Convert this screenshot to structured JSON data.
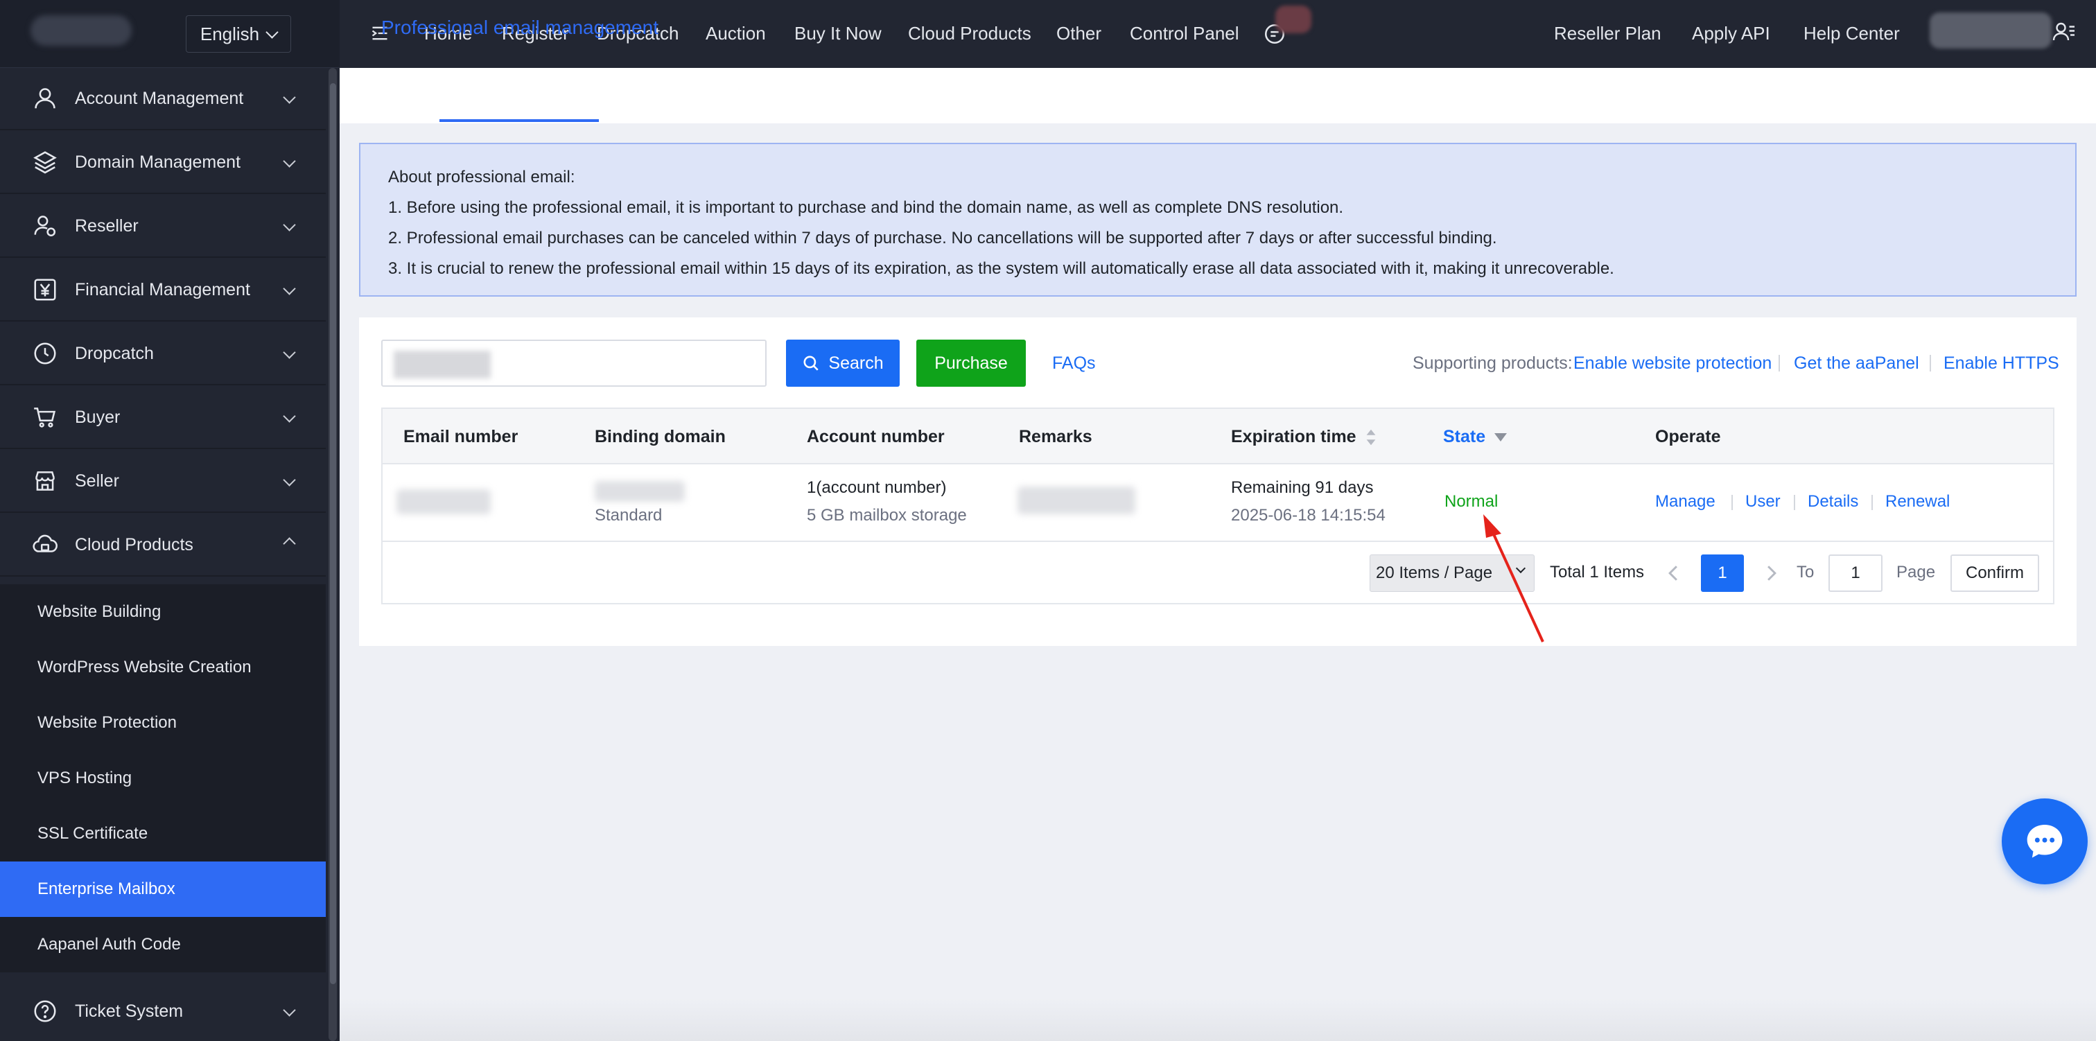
{
  "sidebar": {
    "language": "English",
    "menu": [
      {
        "label": "Account Management",
        "icon": "user-icon"
      },
      {
        "label": "Domain Management",
        "icon": "layers-icon"
      },
      {
        "label": "Reseller",
        "icon": "reseller-icon"
      },
      {
        "label": "Financial Management",
        "icon": "yen-icon"
      },
      {
        "label": "Dropcatch",
        "icon": "clock-icon"
      },
      {
        "label": "Buyer",
        "icon": "cart-icon"
      },
      {
        "label": "Seller",
        "icon": "store-icon"
      },
      {
        "label": "Cloud Products",
        "icon": "cloud-icon"
      }
    ],
    "submenu": [
      "Website Building",
      "WordPress Website Creation",
      "Website Protection",
      "VPS Hosting",
      "SSL Certificate",
      "Enterprise Mailbox",
      "Aapanel Auth Code"
    ],
    "active_submenu": "Enterprise Mailbox",
    "ticket": "Ticket System"
  },
  "topnav": {
    "links": [
      "Home",
      "Register",
      "Dropcatch",
      "Auction",
      "Buy It Now",
      "Cloud Products",
      "Other",
      "Control Panel"
    ],
    "right_links": [
      "Reseller Plan",
      "Apply API",
      "Help Center"
    ]
  },
  "page": {
    "tab": "Professional email management",
    "notice": {
      "title": "About professional email:",
      "lines": [
        "1. Before using the professional email, it is important to purchase and bind the domain name, as well as complete DNS resolution.",
        "2. Professional email purchases can be canceled within 7 days of purchase. No cancellations will be supported after 7 days or after successful binding.",
        "3. It is crucial to renew the professional email within 15 days of its expiration, as the system will automatically erase all data associated with it, making it unrecoverable."
      ]
    },
    "toolbar": {
      "search": "Search",
      "purchase": "Purchase",
      "faqs": "FAQs",
      "supporting_label": "Supporting products:",
      "supporting_links": [
        "Enable website protection",
        "Get the aaPanel",
        "Enable HTTPS"
      ]
    },
    "table": {
      "headers": [
        "Email number",
        "Binding domain",
        "Account number",
        "Remarks",
        "Expiration time",
        "State",
        "Operate"
      ],
      "row": {
        "binding_type": "Standard",
        "account_number": "1(account number)",
        "storage": "5 GB mailbox storage",
        "remaining": "Remaining 91 days",
        "expiration": "2025-06-18 14:15:54",
        "state": "Normal",
        "actions": [
          "Manage",
          "User",
          "Details",
          "Renewal"
        ]
      }
    },
    "pagination": {
      "page_size": "20 Items / Page",
      "total": "Total 1 Items",
      "current_page": "1",
      "to_label": "To",
      "goto_value": "1",
      "page_label": "Page",
      "confirm": "Confirm"
    }
  },
  "colors": {
    "accent": "#1a6cf4",
    "success": "#0fa31a",
    "annotation": "#e5231b"
  }
}
